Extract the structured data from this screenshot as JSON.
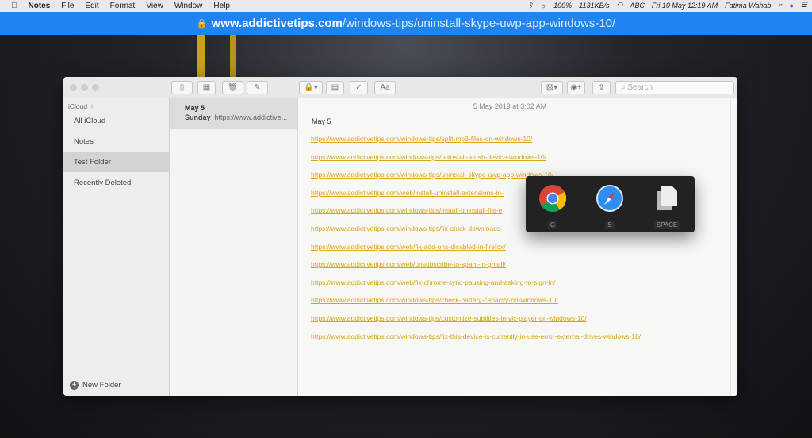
{
  "menubar": {
    "app": "Notes",
    "items": [
      "File",
      "Edit",
      "Format",
      "View",
      "Window",
      "Help"
    ],
    "battery": "100%",
    "network": "1131KB/s",
    "input": "ABC",
    "clock": "Fri 10 May  12:19 AM",
    "user": "Fatima Wahab"
  },
  "urlbar": {
    "domain": "www.addictivetips.com",
    "path": "/windows-tips/uninstall-skype-uwp-app-windows-10/"
  },
  "toolbar": {
    "search_placeholder": "Search",
    "font_button": "Aa"
  },
  "sidebar": {
    "account": "iCloud",
    "items": [
      "All iCloud",
      "Notes",
      "Test Folder",
      "Recently Deleted"
    ],
    "selected": "Test Folder",
    "new_folder": "New Folder"
  },
  "list": {
    "title": "May 5",
    "day": "Sunday",
    "preview": "https://www.addictive..."
  },
  "editor": {
    "date": "5 May 2019 at 3:02 AM",
    "heading": "May 5",
    "links": [
      "https://www.addictivetips.com/windows-tips/split-mp3-files-on-windows-10/",
      "https://www.addictivetips.com/windows-tips/uninstall-a-usb-device-windows-10/",
      "https://www.addictivetips.com/windows-tips/uninstall-skype-uwp-app-windows-10/",
      "https://www.addictivetips.com/web/install-uninstall-extensions-in-",
      "https://www.addictivetips.com/windows-tips/install-uninstall-file-e",
      "https://www.addictivetips.com/windows-tips/fix-stuck-downloads-",
      "https://www.addictivetips.com/web/fix-add-ons-disabled-in-firefox/",
      "https://www.addictivetips.com/web/unsubscribe-to-spam-in-gmail/",
      "https://www.addictivetips.com/web/fix-chrome-sync-pausing-and-asking-to-sign-in/",
      "https://www.addictivetips.com/windows-tips/check-battery-capacity-on-windows-10/",
      "https://www.addictivetips.com/windows-tips/customize-subtitles-in-vlc-player-on-windows-10/",
      "https://www.addictivetips.com/windows-tips/fix-this-device-is-currently-in-use-error-external-drives-windows-10/"
    ]
  },
  "switcher": {
    "apps": [
      {
        "name": "chrome",
        "key": "G"
      },
      {
        "name": "safari",
        "key": "S"
      },
      {
        "name": "copy",
        "key": "SPACE"
      }
    ]
  }
}
